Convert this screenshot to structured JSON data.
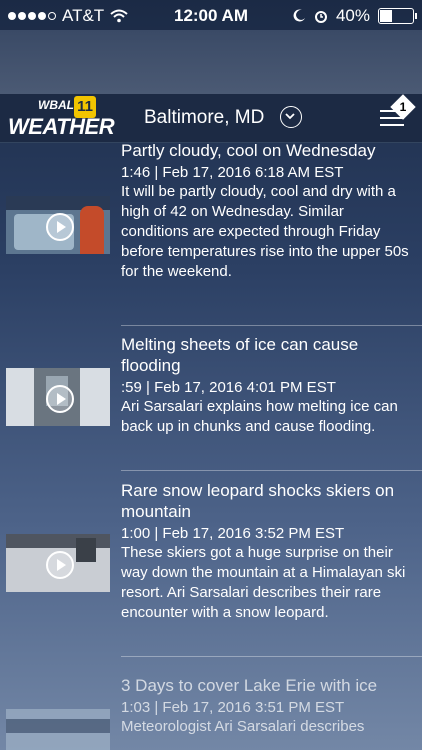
{
  "status_bar": {
    "carrier": "AT&T",
    "time": "12:00 AM",
    "battery": "40%"
  },
  "header": {
    "logo_top": "WBAL",
    "logo_channel": "11",
    "logo_main": "WEATHER",
    "city": "Baltimore, MD",
    "notification_count": "1"
  },
  "stories": [
    {
      "title": "Partly cloudy, cool on Wednesday",
      "meta": "1:46 | Feb 17, 2016 6:18 AM EST",
      "summary": "It will be partly cloudy, cool and dry with a high of 42 on Wednesday. Similar conditions are expected through Friday before temperatures rise into the upper 50s for the weekend."
    },
    {
      "title": "Melting sheets of ice can cause flooding",
      "meta": ":59 | Feb 17, 2016 4:01 PM EST",
      "summary": "Ari Sarsalari explains how melting ice can back up in chunks and cause flooding."
    },
    {
      "title": "Rare snow leopard shocks skiers on mountain",
      "meta": "1:00 | Feb 17, 2016 3:52 PM EST",
      "summary": "These skiers got a huge surprise on their way down the mountain at a Himalayan ski resort. Ari Sarsalari describes their rare encounter with a snow leopard."
    },
    {
      "title": "3 Days to cover Lake Erie with ice",
      "meta": "1:03 | Feb 17, 2016 3:51 PM EST",
      "summary": "Meteorologist Ari Sarsalari describes"
    }
  ]
}
